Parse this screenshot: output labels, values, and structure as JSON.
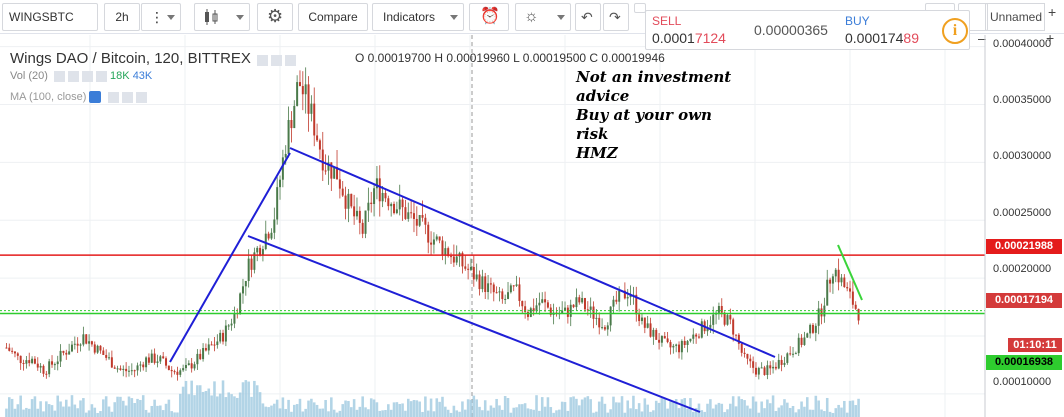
{
  "toolbar": {
    "symbol": "WINGSBTC",
    "interval": "2h",
    "compare_label": "Compare",
    "indicators_label": "Indicators",
    "layout_name": "Unnamed"
  },
  "quote": {
    "sell_label": "SELL",
    "sell_price_main": "0.0001",
    "sell_price_hl": "7124",
    "spread": "0.00000365",
    "buy_label": "BUY",
    "buy_price_main": "0.000174",
    "buy_price_hl": "89"
  },
  "legend": {
    "title": "Wings DAO / Bitcoin, 120, BITTREX",
    "ohlc": "O 0.00019700  H 0.00019960  L 0.00019500  C 0.00019946",
    "vol_label": "Vol (20)",
    "vol_values_a": "18K",
    "vol_values_b": "43K",
    "ma_label": "MA (100, close)"
  },
  "annotation": {
    "lines": [
      "Not an investment",
      "advice",
      "Buy at your own",
      "risk",
      "HMZ"
    ]
  },
  "price_axis": {
    "ticks": [
      "0.00040000",
      "0.00035000",
      "0.00030000",
      "0.00025000",
      "0.00020000",
      "0.00010000"
    ],
    "resistance_tag": "0.00021988",
    "last_price_tag": "0.00017194",
    "countdown": "01:10:11",
    "support_tag": "0.00016938"
  },
  "colors": {
    "resistance": "#e41c1c",
    "support": "#2ecc2e",
    "channel": "#1f1fd6",
    "up_candle": "#4a7a4a",
    "down_candle": "#c0392b",
    "volume": "#9fc9e0"
  },
  "chart_data": {
    "type": "candlestick",
    "ylim": [
      8e-05,
      0.00041
    ],
    "resistance_level": 0.00021988,
    "support_level": 0.00016938,
    "last_price": 0.00017194,
    "path": [
      [
        0.00014,
        0.00013,
        0.00013,
        0.00012,
        0.00013,
        0.00014,
        0.00015,
        0.00014,
        0.00013,
        0.00012,
        0.00012,
        0.00013,
        0.00013,
        0.00012,
        0.00012,
        0.00013,
        0.00014,
        0.00015,
        0.00017,
        0.00021,
        0.00023,
        0.00025,
        0.00032,
        0.00037,
        0.00034,
        0.0003,
        0.00029,
        0.00026,
        0.00024,
        0.00028,
        0.00027,
        0.00026,
        0.00025,
        0.00024,
        0.00023,
        0.00022,
        0.00021,
        0.0002,
        0.00019,
        0.00018,
        0.00019,
        0.00017,
        0.00018,
        0.00017,
        0.00017,
        0.00018,
        0.00017,
        0.00016,
        0.00018,
        0.00019,
        0.00016,
        0.00015,
        0.00014,
        0.00014,
        0.00015,
        0.00016,
        0.00017,
        0.00016,
        0.00013,
        0.00012,
        0.00012,
        0.00013,
        0.00014,
        0.00015,
        0.00017,
        0.00021,
        0.00019,
        0.00017
      ]
    ]
  }
}
